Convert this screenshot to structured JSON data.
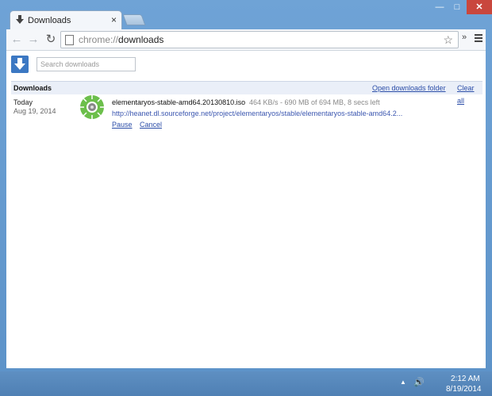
{
  "tab": {
    "title": "Downloads",
    "close": "×"
  },
  "window": {
    "minimize": "—",
    "maximize": "□",
    "close": "✕"
  },
  "toolbar": {
    "back": "←",
    "forward": "→",
    "reload": "↻",
    "url_scheme": "chrome://",
    "url_host": "downloads",
    "star": "☆",
    "extensions": "»"
  },
  "page": {
    "search_placeholder": "Search downloads",
    "section_title": "Downloads",
    "open_folder_link": "Open downloads folder",
    "clear_all_link": "Clear all"
  },
  "downloads": [
    {
      "date_day": "Today",
      "date_full": "Aug 19, 2014",
      "file_name": "elementaryos-stable-amd64.20130810.iso",
      "status": "464 KB/s - 690 MB of 694 MB, 8 secs left",
      "url": "http://heanet.dl.sourceforge.net/project/elementaryos/stable/elementaryos-stable-amd64.2...",
      "progress": 0.994,
      "actions": {
        "pause": "Pause",
        "cancel": "Cancel"
      }
    }
  ],
  "taskbar": {
    "time": "2:12 AM",
    "date": "8/19/2014",
    "tray_arrow": "▲",
    "volume": "🔊"
  },
  "colors": {
    "accent": "#3c78c3",
    "progress": "#6cbf4b",
    "link": "#2c4ea8"
  }
}
